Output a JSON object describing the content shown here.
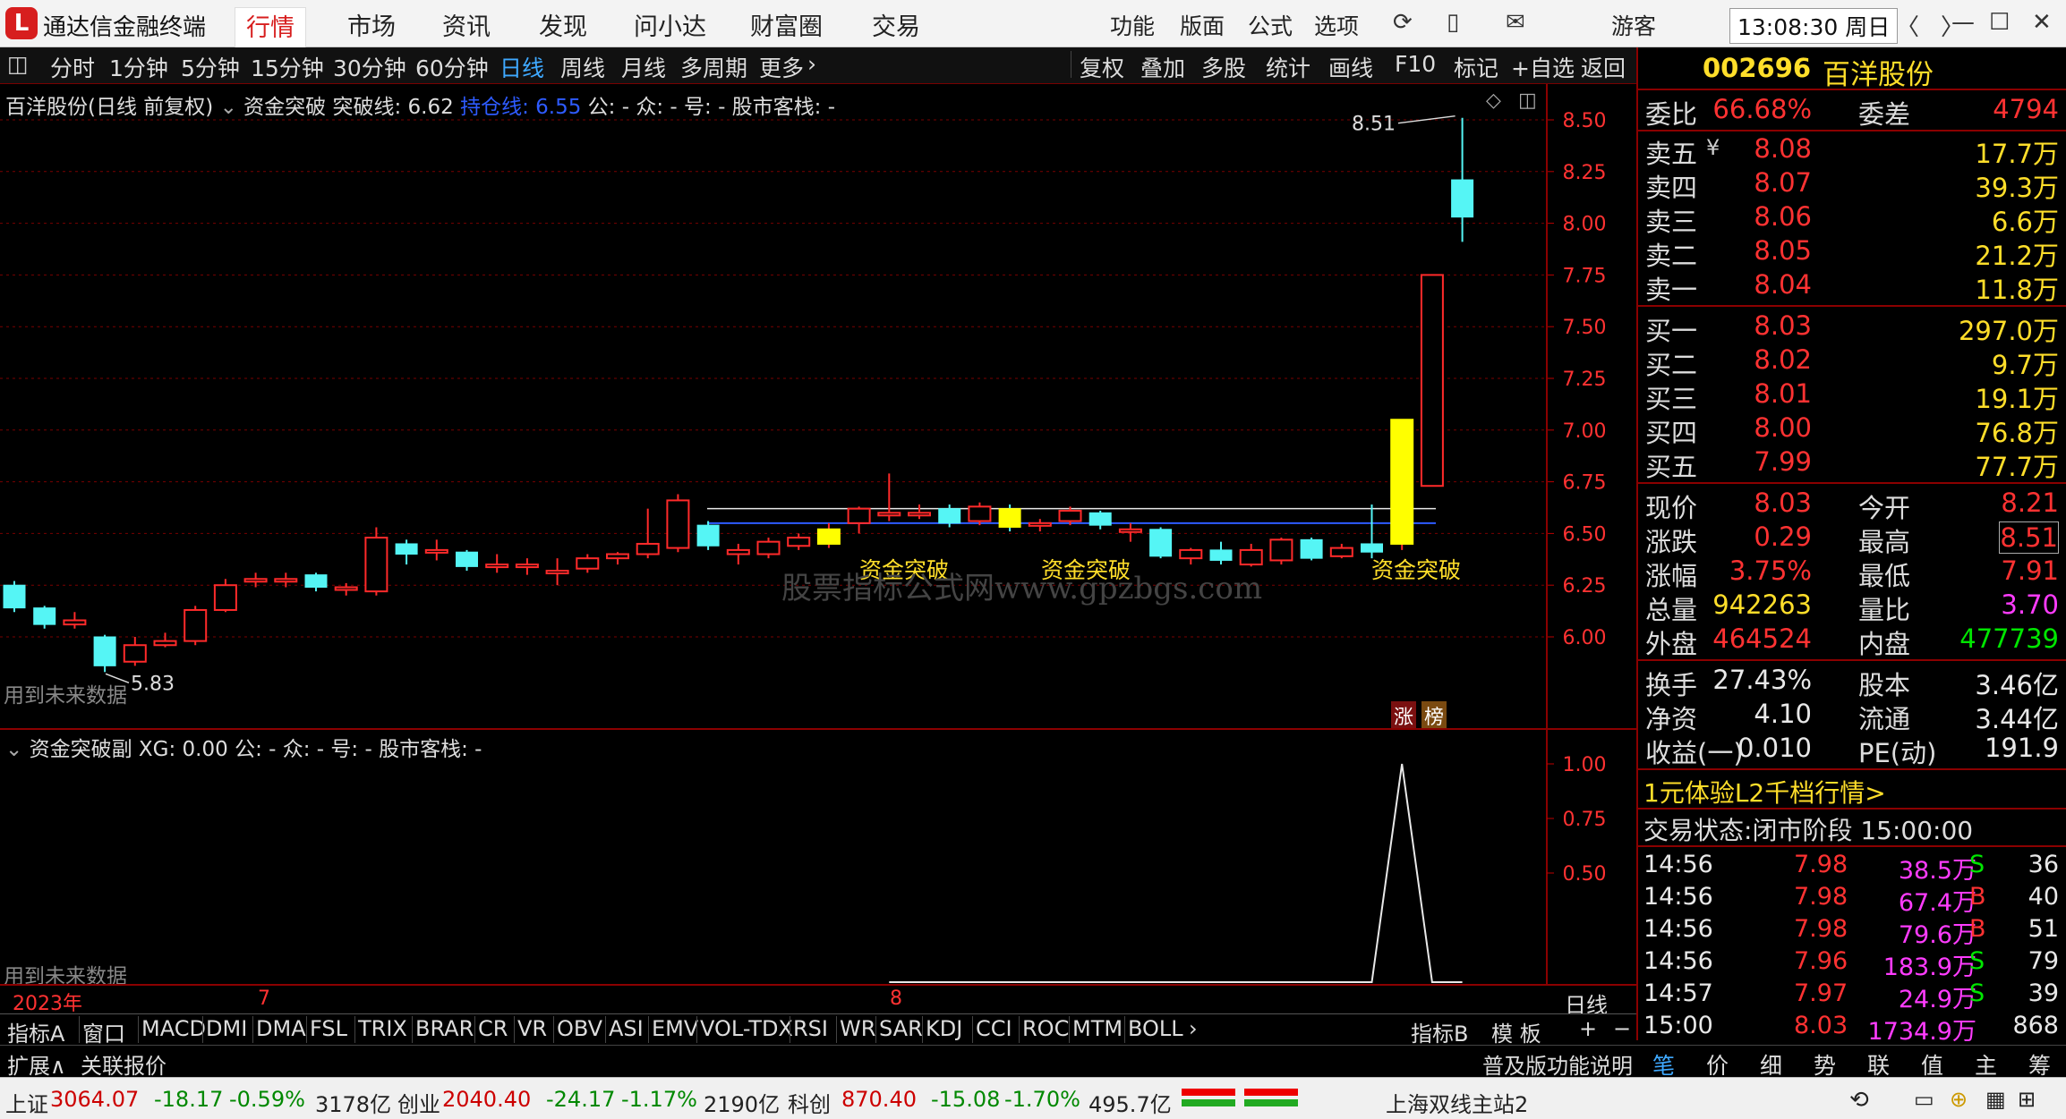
{
  "app": {
    "name": "通达信金融终端",
    "nav_tabs": [
      "行情",
      "市场",
      "资讯",
      "发现",
      "问小达",
      "财富圈",
      "交易"
    ],
    "right_menu": [
      "功能",
      "版面",
      "公式",
      "选项"
    ],
    "user": "游客",
    "clock": "13:08:30 周日"
  },
  "toolbar": {
    "periods": [
      "分时",
      "1分钟",
      "5分钟",
      "15分钟",
      "30分钟",
      "60分钟",
      "日线",
      "周线",
      "月线",
      "多周期",
      "更多"
    ],
    "active_period": "日线",
    "actions": [
      "复权",
      "叠加",
      "多股",
      "统计",
      "画线",
      "F10",
      "标记",
      "+自选",
      "返回"
    ]
  },
  "main_chart": {
    "header_stock": "百洋股份(日线 前复权)",
    "header_indicator": "资金突破",
    "header_breakout": "突破线: 6.62",
    "header_hold": "持仓线: 6.55",
    "header_tail": "公: - 众: - 号: - 股市客栈: -",
    "future_note": "用到未来数据",
    "high_label": "8.51",
    "low_label": "5.83",
    "signal_label": "资金突破",
    "watermark": "股票指标公式网www.gpzbgs.com",
    "badge_zhang": "涨",
    "badge_bang": "榜"
  },
  "chart_data": [
    {
      "type": "candlestick",
      "yticks": [
        "8.50",
        "8.25",
        "8.00",
        "7.75",
        "7.50",
        "7.25",
        "7.00",
        "6.75",
        "6.50",
        "6.25",
        "6.00"
      ],
      "ylim": [
        5.83,
        8.51
      ],
      "breakout_line": 6.62,
      "hold_line": 6.55,
      "candles": [
        {
          "o": 6.25,
          "c": 6.14,
          "h": 6.27,
          "l": 6.12
        },
        {
          "o": 6.14,
          "c": 6.06,
          "h": 6.15,
          "l": 6.04
        },
        {
          "o": 6.06,
          "c": 6.08,
          "h": 6.12,
          "l": 6.04
        },
        {
          "o": 6.0,
          "c": 5.86,
          "h": 6.01,
          "l": 5.83
        },
        {
          "o": 5.88,
          "c": 5.96,
          "h": 6.0,
          "l": 5.86
        },
        {
          "o": 5.96,
          "c": 5.98,
          "h": 6.02,
          "l": 5.95
        },
        {
          "o": 5.98,
          "c": 6.13,
          "h": 6.15,
          "l": 5.96
        },
        {
          "o": 6.13,
          "c": 6.25,
          "h": 6.28,
          "l": 6.12
        },
        {
          "o": 6.27,
          "c": 6.28,
          "h": 6.31,
          "l": 6.24
        },
        {
          "o": 6.27,
          "c": 6.28,
          "h": 6.31,
          "l": 6.24
        },
        {
          "o": 6.3,
          "c": 6.24,
          "h": 6.31,
          "l": 6.22
        },
        {
          "o": 6.23,
          "c": 6.24,
          "h": 6.26,
          "l": 6.2
        },
        {
          "o": 6.22,
          "c": 6.48,
          "h": 6.53,
          "l": 6.2
        },
        {
          "o": 6.45,
          "c": 6.4,
          "h": 6.47,
          "l": 6.35
        },
        {
          "o": 6.41,
          "c": 6.42,
          "h": 6.47,
          "l": 6.37
        },
        {
          "o": 6.41,
          "c": 6.34,
          "h": 6.42,
          "l": 6.32
        },
        {
          "o": 6.34,
          "c": 6.35,
          "h": 6.4,
          "l": 6.31
        },
        {
          "o": 6.34,
          "c": 6.35,
          "h": 6.38,
          "l": 6.3
        },
        {
          "o": 6.31,
          "c": 6.32,
          "h": 6.38,
          "l": 6.25
        },
        {
          "o": 6.33,
          "c": 6.38,
          "h": 6.4,
          "l": 6.31
        },
        {
          "o": 6.38,
          "c": 6.4,
          "h": 6.41,
          "l": 6.35
        },
        {
          "o": 6.4,
          "c": 6.45,
          "h": 6.62,
          "l": 6.38
        },
        {
          "o": 6.43,
          "c": 6.66,
          "h": 6.69,
          "l": 6.41
        },
        {
          "o": 6.54,
          "c": 6.44,
          "h": 6.56,
          "l": 6.42
        },
        {
          "o": 6.4,
          "c": 6.42,
          "h": 6.45,
          "l": 6.35
        },
        {
          "o": 6.4,
          "c": 6.46,
          "h": 6.48,
          "l": 6.38
        },
        {
          "o": 6.44,
          "c": 6.48,
          "h": 6.5,
          "l": 6.42
        },
        {
          "o": 6.45,
          "c": 6.52,
          "h": 6.55,
          "l": 6.43
        },
        {
          "o": 6.55,
          "c": 6.62,
          "h": 6.63,
          "l": 6.5
        },
        {
          "o": 6.6,
          "c": 6.6,
          "h": 6.79,
          "l": 6.56
        },
        {
          "o": 6.59,
          "c": 6.6,
          "h": 6.64,
          "l": 6.57
        },
        {
          "o": 6.62,
          "c": 6.55,
          "h": 6.64,
          "l": 6.53
        },
        {
          "o": 6.56,
          "c": 6.63,
          "h": 6.65,
          "l": 6.54
        },
        {
          "o": 6.62,
          "c": 6.53,
          "h": 6.64,
          "l": 6.51
        },
        {
          "o": 6.55,
          "c": 6.55,
          "h": 6.57,
          "l": 6.51
        },
        {
          "o": 6.56,
          "c": 6.61,
          "h": 6.63,
          "l": 6.54
        },
        {
          "o": 6.6,
          "c": 6.54,
          "h": 6.61,
          "l": 6.52
        },
        {
          "o": 6.52,
          "c": 6.52,
          "h": 6.55,
          "l": 6.46
        },
        {
          "o": 6.52,
          "c": 6.39,
          "h": 6.53,
          "l": 6.38
        },
        {
          "o": 6.38,
          "c": 6.42,
          "h": 6.43,
          "l": 6.35
        },
        {
          "o": 6.42,
          "c": 6.37,
          "h": 6.46,
          "l": 6.35
        },
        {
          "o": 6.35,
          "c": 6.42,
          "h": 6.45,
          "l": 6.34
        },
        {
          "o": 6.37,
          "c": 6.47,
          "h": 6.48,
          "l": 6.35
        },
        {
          "o": 6.47,
          "c": 6.38,
          "h": 6.48,
          "l": 6.37
        },
        {
          "o": 6.39,
          "c": 6.43,
          "h": 6.45,
          "l": 6.38
        },
        {
          "o": 6.45,
          "c": 6.41,
          "h": 6.64,
          "l": 6.38
        },
        {
          "o": 6.45,
          "c": 7.05,
          "h": 7.05,
          "l": 6.42
        },
        {
          "o": 6.73,
          "c": 7.75,
          "h": 7.75,
          "l": 6.73
        },
        {
          "o": 8.21,
          "c": 8.03,
          "h": 8.51,
          "l": 7.91
        }
      ],
      "signals": [
        27,
        33,
        46
      ]
    },
    {
      "type": "line",
      "yticks": [
        "1.00",
        "0.75",
        "0.50"
      ],
      "ylim": [
        0,
        1
      ],
      "values": [
        0,
        0,
        0,
        0,
        0,
        0,
        0,
        0,
        0,
        0,
        0,
        0,
        0,
        0,
        0,
        0,
        0,
        0,
        0,
        0,
        0,
        0,
        0,
        0,
        0,
        0,
        0,
        0,
        0,
        0,
        0,
        0,
        0,
        0,
        0,
        0,
        0,
        0,
        0,
        0,
        0,
        0,
        0,
        0,
        0,
        0,
        1,
        0,
        0
      ],
      "start_index": 29
    }
  ],
  "sub_chart": {
    "header": "资金突破副 XG: 0.00 公: - 众: - 号: - 股市客栈: -",
    "future_note": "用到未来数据",
    "x_labels": [
      "2023年",
      "7",
      "8"
    ],
    "period_label": "日线"
  },
  "indicator_bar": {
    "label_a": "指标A",
    "items": [
      "窗口",
      "MACD",
      "DMI",
      "DMA",
      "FSL",
      "TRIX",
      "BRAR",
      "CR",
      "VR",
      "OBV",
      "ASI",
      "EMV",
      "VOL-TDX",
      "RSI",
      "WR",
      "SAR",
      "KDJ",
      "CCI",
      "ROC",
      "MTM",
      "BOLL"
    ],
    "label_b": "指标B",
    "mode": "模 板"
  },
  "ext_bar": {
    "items": [
      "扩展∧",
      "关联报价"
    ],
    "help": "普及版功能说明"
  },
  "quote": {
    "code": "002696",
    "name": "百洋股份",
    "weibi_label": "委比",
    "weibi": "66.68%",
    "weicha_label": "委差",
    "weicha": "4794",
    "asks": [
      {
        "label": "卖五",
        "price": "8.08",
        "vol": "17.7万"
      },
      {
        "label": "卖四",
        "price": "8.07",
        "vol": "39.3万"
      },
      {
        "label": "卖三",
        "price": "8.06",
        "vol": "6.6万"
      },
      {
        "label": "卖二",
        "price": "8.05",
        "vol": "21.2万"
      },
      {
        "label": "卖一",
        "price": "8.04",
        "vol": "11.8万"
      }
    ],
    "bids": [
      {
        "label": "买一",
        "price": "8.03",
        "vol": "297.0万"
      },
      {
        "label": "买二",
        "price": "8.02",
        "vol": "9.7万"
      },
      {
        "label": "买三",
        "price": "8.01",
        "vol": "19.1万"
      },
      {
        "label": "买四",
        "price": "8.00",
        "vol": "76.8万"
      },
      {
        "label": "买五",
        "price": "7.99",
        "vol": "77.7万"
      }
    ],
    "stats": [
      {
        "l1": "现价",
        "v1": "8.03",
        "l2": "今开",
        "v2": "8.21",
        "c1": "red",
        "c2": "red"
      },
      {
        "l1": "涨跌",
        "v1": "0.29",
        "l2": "最高",
        "v2": "8.51",
        "c1": "red",
        "c2": "red"
      },
      {
        "l1": "涨幅",
        "v1": "3.75%",
        "l2": "最低",
        "v2": "7.91",
        "c1": "red",
        "c2": "red"
      },
      {
        "l1": "总量",
        "v1": "942263",
        "l2": "量比",
        "v2": "3.70",
        "c1": "yel",
        "c2": "mag"
      },
      {
        "l1": "外盘",
        "v1": "464524",
        "l2": "内盘",
        "v2": "477739",
        "c1": "red",
        "c2": "grn"
      }
    ],
    "stats2": [
      {
        "l1": "换手",
        "v1": "27.43%",
        "l2": "股本",
        "v2": "3.46亿"
      },
      {
        "l1": "净资",
        "v1": "4.10",
        "l2": "流通",
        "v2": "3.44亿"
      },
      {
        "l1": "收益(一)",
        "v1": "0.010",
        "l2": "PE(动)",
        "v2": "191.9"
      }
    ],
    "promo": "1元体验L2千档行情>",
    "status_label": "交易状态:",
    "status_value": "闭市阶段 15:00:00",
    "ticks": [
      {
        "t": "14:56",
        "p": "7.98",
        "v": "38.5万",
        "d": "S",
        "n": "36"
      },
      {
        "t": "14:56",
        "p": "7.98",
        "v": "67.4万",
        "d": "B",
        "n": "40"
      },
      {
        "t": "14:56",
        "p": "7.98",
        "v": "79.6万",
        "d": "B",
        "n": "51"
      },
      {
        "t": "14:56",
        "p": "7.96",
        "v": "183.9万",
        "d": "S",
        "n": "79"
      },
      {
        "t": "14:57",
        "p": "7.97",
        "v": "24.9万",
        "d": "S",
        "n": "39"
      },
      {
        "t": "15:00",
        "p": "8.03",
        "v": "1734.9万",
        "d": "",
        "n": "868"
      }
    ],
    "tabs": [
      "笔",
      "价",
      "细",
      "势",
      "联",
      "值",
      "主",
      "筹"
    ]
  },
  "status_bar": {
    "sh_label": "上证",
    "sh_val": "3064.07",
    "sh_chg": "-18.17",
    "sh_pct": "-0.59%",
    "sh_amt": "3178亿",
    "cy_label": "创业",
    "cy_val": "2040.40",
    "cy_chg": "-24.17",
    "cy_pct": "-1.17%",
    "cy_amt": "2190亿",
    "kc_label": "科创",
    "kc_val": "870.40",
    "kc_chg": "-15.08",
    "kc_pct": "-1.70%",
    "kc_amt": "495.7亿",
    "server": "上海双线主站2"
  }
}
